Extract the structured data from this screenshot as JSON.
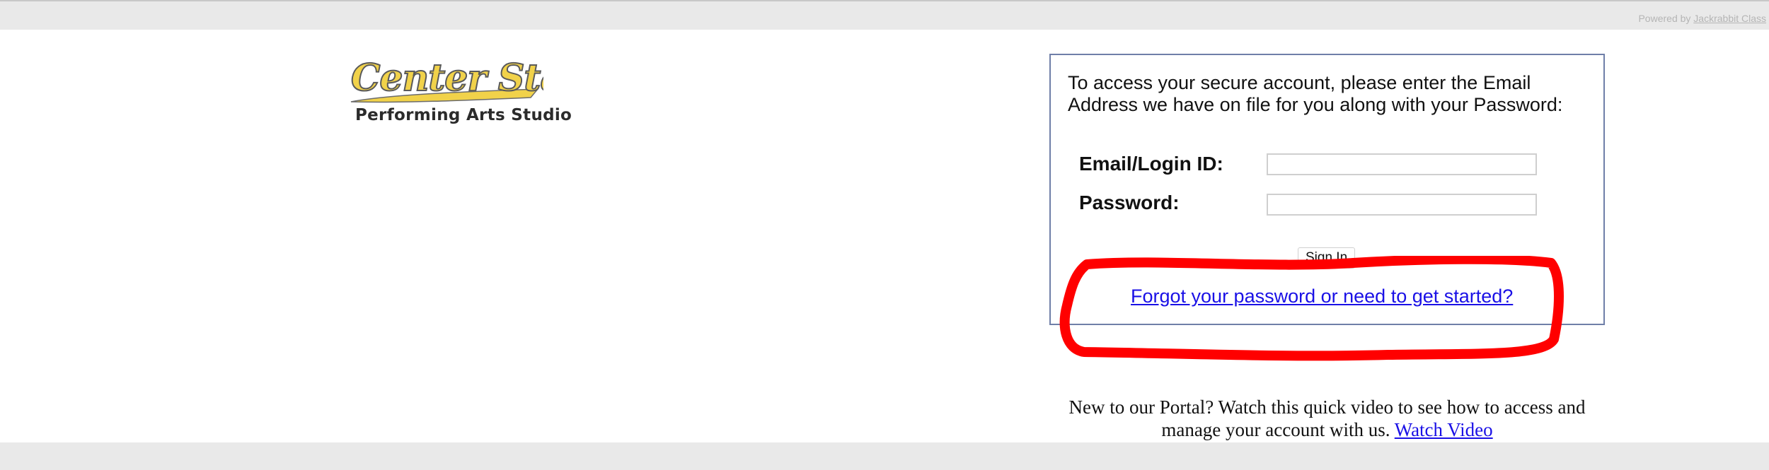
{
  "header": {
    "powered_by_prefix": "Powered by ",
    "powered_by_link": "Jackrabbit Class"
  },
  "logo": {
    "title": "Center Stage",
    "subtitle": "Performing Arts Studio",
    "accent_color": "#f1d24a",
    "outline_color": "#6b6b6b"
  },
  "login": {
    "intro": "To access your secure account, please enter the Email Address we have on file for you along with your Password:",
    "email_label": "Email/Login ID:",
    "email_value": "",
    "password_label": "Password:",
    "password_value": "",
    "sign_in_label": "Sign In",
    "forgot_link": "Forgot your password or need to get started?"
  },
  "annotation": {
    "highlight_color": "#ff0000"
  },
  "notice": {
    "text": "New to our Portal? Watch this quick video to see how to access and manage your account with us. ",
    "link": "Watch Video"
  }
}
